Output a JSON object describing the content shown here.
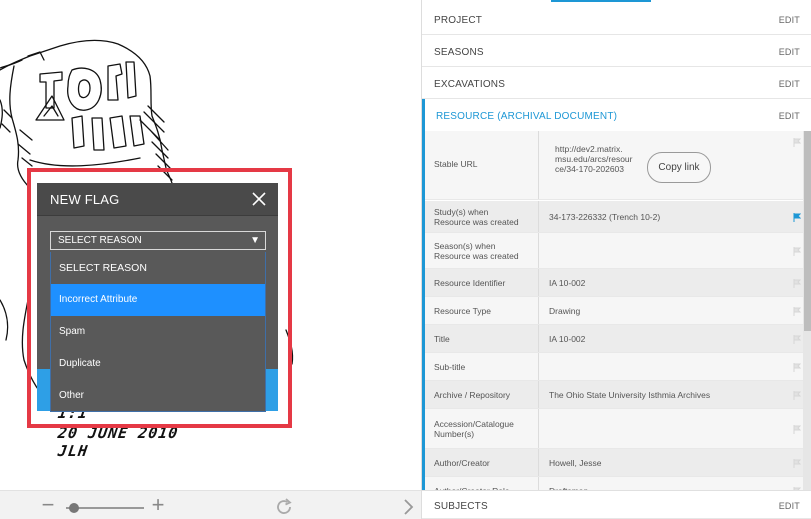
{
  "viewer": {
    "handwriting_lines": [
      "1:1",
      "20 JUNE 2010",
      "JLH"
    ]
  },
  "toolbar": {
    "zoom_out": "−",
    "zoom_in": "+",
    "zoom_level": 0.07
  },
  "flag_modal": {
    "title": "NEW FLAG",
    "select_value": "SELECT REASON",
    "options": [
      "SELECT REASON",
      "Incorrect Attribute",
      "Spam",
      "Duplicate",
      "Other"
    ],
    "highlighted_option": "Incorrect Attribute"
  },
  "sections": {
    "project": "PROJECT",
    "seasons": "SEASONS",
    "excavations": "EXCAVATIONS",
    "resource": "RESOURCE (ARCHIVAL DOCUMENT)",
    "subjects": "SUBJECTS",
    "edit": "EDIT"
  },
  "resource_table": {
    "stable_url_label": "Stable URL",
    "stable_url_lines": [
      "http://dev2.matrix.",
      "msu.edu/arcs/resour",
      "ce/34-170-202603"
    ],
    "copy_link": "Copy link",
    "rows": [
      {
        "label": [
          "Study(s) when",
          "Resource was created"
        ],
        "value": "34-173-226332 (Trench 10-2)",
        "flagged": true
      },
      {
        "label": [
          "Season(s) when",
          "Resource was created"
        ],
        "value": "",
        "flagged": false
      },
      {
        "label": [
          "Resource Identifier"
        ],
        "value": "IA 10-002",
        "flagged": false
      },
      {
        "label": [
          "Resource Type"
        ],
        "value": "Drawing",
        "flagged": false
      },
      {
        "label": [
          "Title"
        ],
        "value": "IA 10-002",
        "flagged": false
      },
      {
        "label": [
          "Sub-title"
        ],
        "value": "",
        "flagged": false
      },
      {
        "label": [
          "Archive / Repository"
        ],
        "value": "The Ohio State University Isthmia Archives",
        "flagged": false
      },
      {
        "label": [
          "Accession/Catalogue",
          "Number(s)"
        ],
        "value": "",
        "flagged": false
      },
      {
        "label": [
          "Author/Creator"
        ],
        "value": "Howell, Jesse",
        "flagged": false
      },
      {
        "label": [
          "Author/Creator Role"
        ],
        "value": "Draftsman",
        "flagged": false
      }
    ]
  },
  "colors": {
    "accent": "#1d97d5",
    "highlight_box": "#e53945",
    "selected_option": "#1e90ff",
    "modal_bg": "#595959"
  },
  "icons": [
    "close-icon",
    "flag-icon",
    "rotate-icon",
    "chevron-right-icon",
    "minus-icon",
    "plus-icon"
  ]
}
